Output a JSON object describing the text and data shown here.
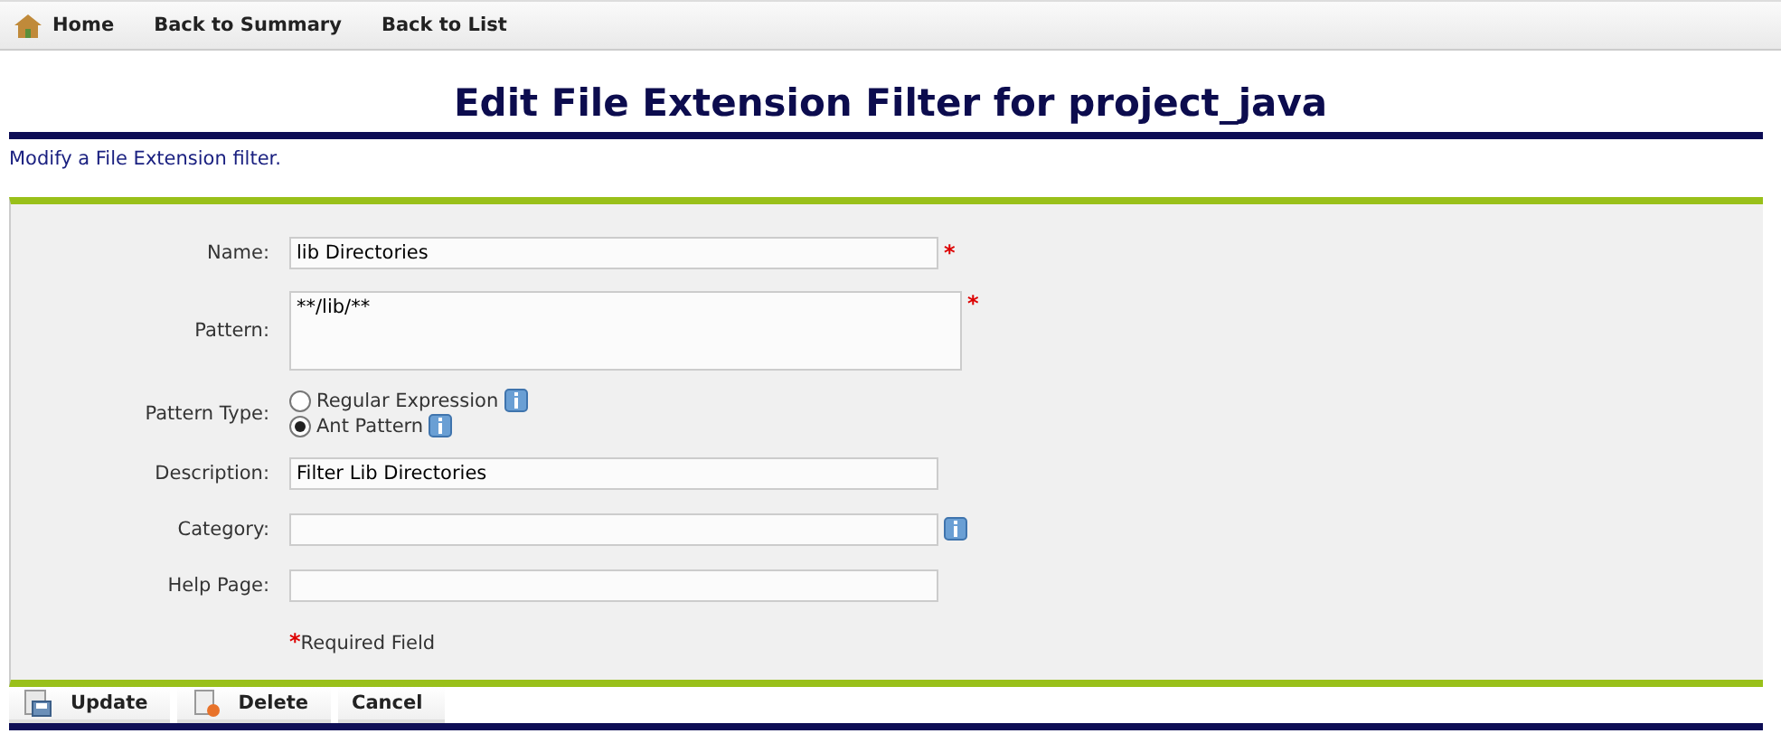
{
  "nav": [
    {
      "label": "Home"
    },
    {
      "label": "Back to Summary"
    },
    {
      "label": "Back to List"
    }
  ],
  "title": "Edit File Extension Filter for project_java",
  "description": "Modify a File Extension filter.",
  "required_mark": "*",
  "fields": [
    {
      "kind": "text",
      "label": "Name:",
      "value": "lib Directories",
      "required": true,
      "info": false
    },
    {
      "kind": "textarea",
      "label": "Pattern:",
      "value": "**/lib/**",
      "required": true,
      "info": false
    },
    {
      "kind": "radio",
      "label": "Pattern Type:",
      "options": [
        {
          "label": "Regular Expression",
          "selected": false,
          "info": true
        },
        {
          "label": "Ant Pattern",
          "selected": true,
          "info": true
        }
      ]
    },
    {
      "kind": "text",
      "label": "Description:",
      "value": "Filter Lib Directories",
      "required": false,
      "info": false
    },
    {
      "kind": "text",
      "label": "Category:",
      "required": false,
      "info": true
    },
    {
      "kind": "text",
      "label": "Help Page:",
      "required": false,
      "info": false
    }
  ],
  "required_note": "Required Field",
  "actions": [
    {
      "label": "Update"
    },
    {
      "label": "Delete"
    },
    {
      "label": "Cancel"
    }
  ]
}
